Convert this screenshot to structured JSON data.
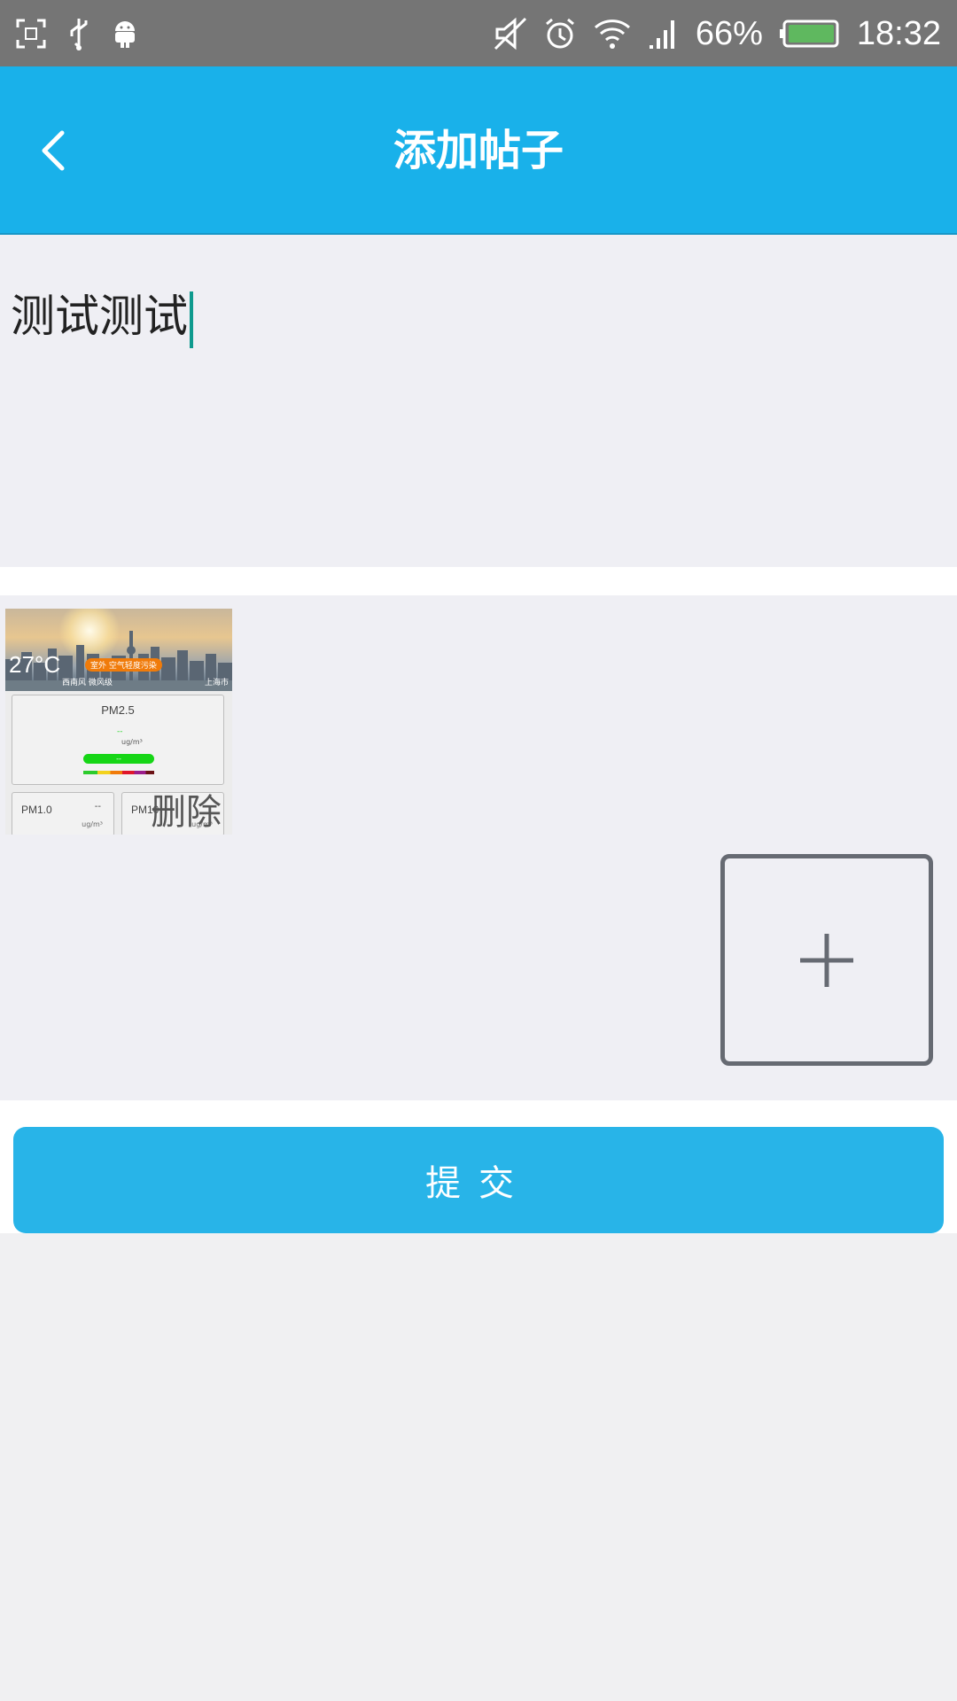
{
  "status_bar": {
    "battery_percent": "66%",
    "time": "18:32",
    "left_icons": [
      "screenshot-icon",
      "usb-icon",
      "android-icon"
    ],
    "right_icons": [
      "mute-icon",
      "alarm-icon",
      "wifi-icon",
      "signal-icon",
      "battery-icon"
    ]
  },
  "header": {
    "title": "添加帖子",
    "back_icon": "chevron-left-icon",
    "background_color": "#19b1ea"
  },
  "post": {
    "text": "测试测试"
  },
  "attachment": {
    "weather": {
      "temperature": "27°C",
      "air_quality_badge": "室外 空气轻度污染",
      "wind": "西南风 微风级",
      "city": "上海市"
    },
    "pm25": {
      "label": "PM2.5",
      "value": "--",
      "unit": "ug/m³",
      "bar_text": "--"
    },
    "pm10": {
      "label": "PM1.0",
      "value": "--",
      "unit": "ug/m³"
    },
    "pm_other": {
      "label": "PM10",
      "unit": "ug/m³"
    },
    "delete_label": "删除"
  },
  "add_image": {
    "icon": "plus-icon"
  },
  "submit": {
    "label": "提交",
    "color": "#28b4e8"
  }
}
